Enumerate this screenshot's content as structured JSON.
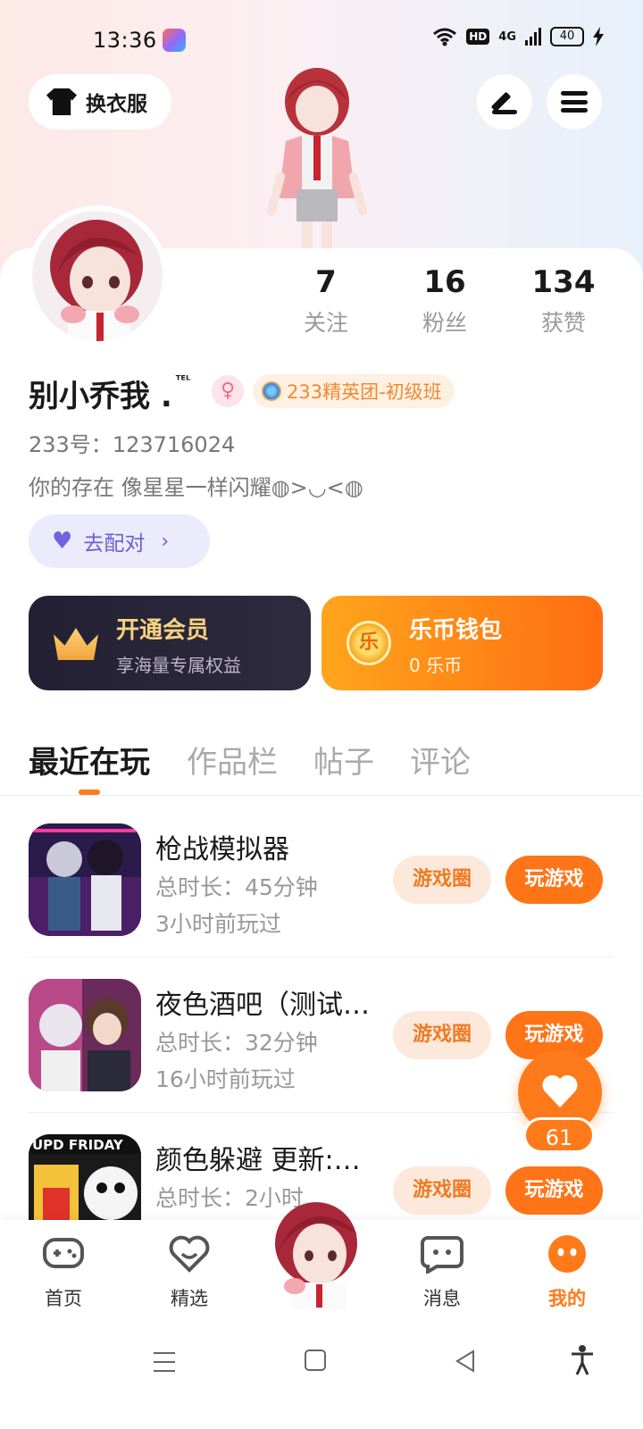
{
  "status_bar": {
    "time": "13:36",
    "network": "4G",
    "hd": "HD",
    "battery": "40"
  },
  "header": {
    "dress_up_label": "换衣服",
    "edit_icon": "pen-icon",
    "menu_icon": "menu-icon"
  },
  "stats": [
    {
      "value": "7",
      "label": "关注"
    },
    {
      "value": "16",
      "label": "粉丝"
    },
    {
      "value": "134",
      "label": "获赞"
    }
  ],
  "profile": {
    "name": "别小乔我 .",
    "name_suffix": "ᵀᴱᴸ",
    "gender_icon": "♀",
    "club_badge": "233精英团-初级班",
    "uid_label": "233号：",
    "uid": "123716024",
    "bio": "你的存在 像星星一样闪耀◍>◡<◍",
    "match_label": "去配对"
  },
  "cards": {
    "vip": {
      "title": "开通会员",
      "subtitle": "享海量专属权益"
    },
    "wallet": {
      "title": "乐币钱包",
      "subtitle": "0 乐币",
      "coin_glyph": "乐"
    }
  },
  "tabs": [
    "最近在玩",
    "作品栏",
    "帖子",
    "评论"
  ],
  "games": [
    {
      "title": "枪战模拟器",
      "duration": "总时长：45分钟",
      "last_played": "3小时前玩过",
      "circle_label": "游戏圈",
      "play_label": "玩游戏"
    },
    {
      "title": "夜色酒吧（测试…",
      "duration": "总时长：32分钟",
      "last_played": "16小时前玩过",
      "circle_label": "游戏圈",
      "play_label": "玩游戏"
    },
    {
      "title": "颜色躲避 更新:…",
      "duration": "总时长：2小时",
      "last_played": "",
      "circle_label": "游戏圈",
      "play_label": "玩游戏"
    }
  ],
  "like_fab": {
    "count": "61"
  },
  "bottom_nav": [
    {
      "label": "首页"
    },
    {
      "label": "精选"
    },
    {
      "label": "消息"
    },
    {
      "label": "我的"
    }
  ],
  "colors": {
    "accent": "#ff7417",
    "vip_gold": "#f6d27f"
  }
}
